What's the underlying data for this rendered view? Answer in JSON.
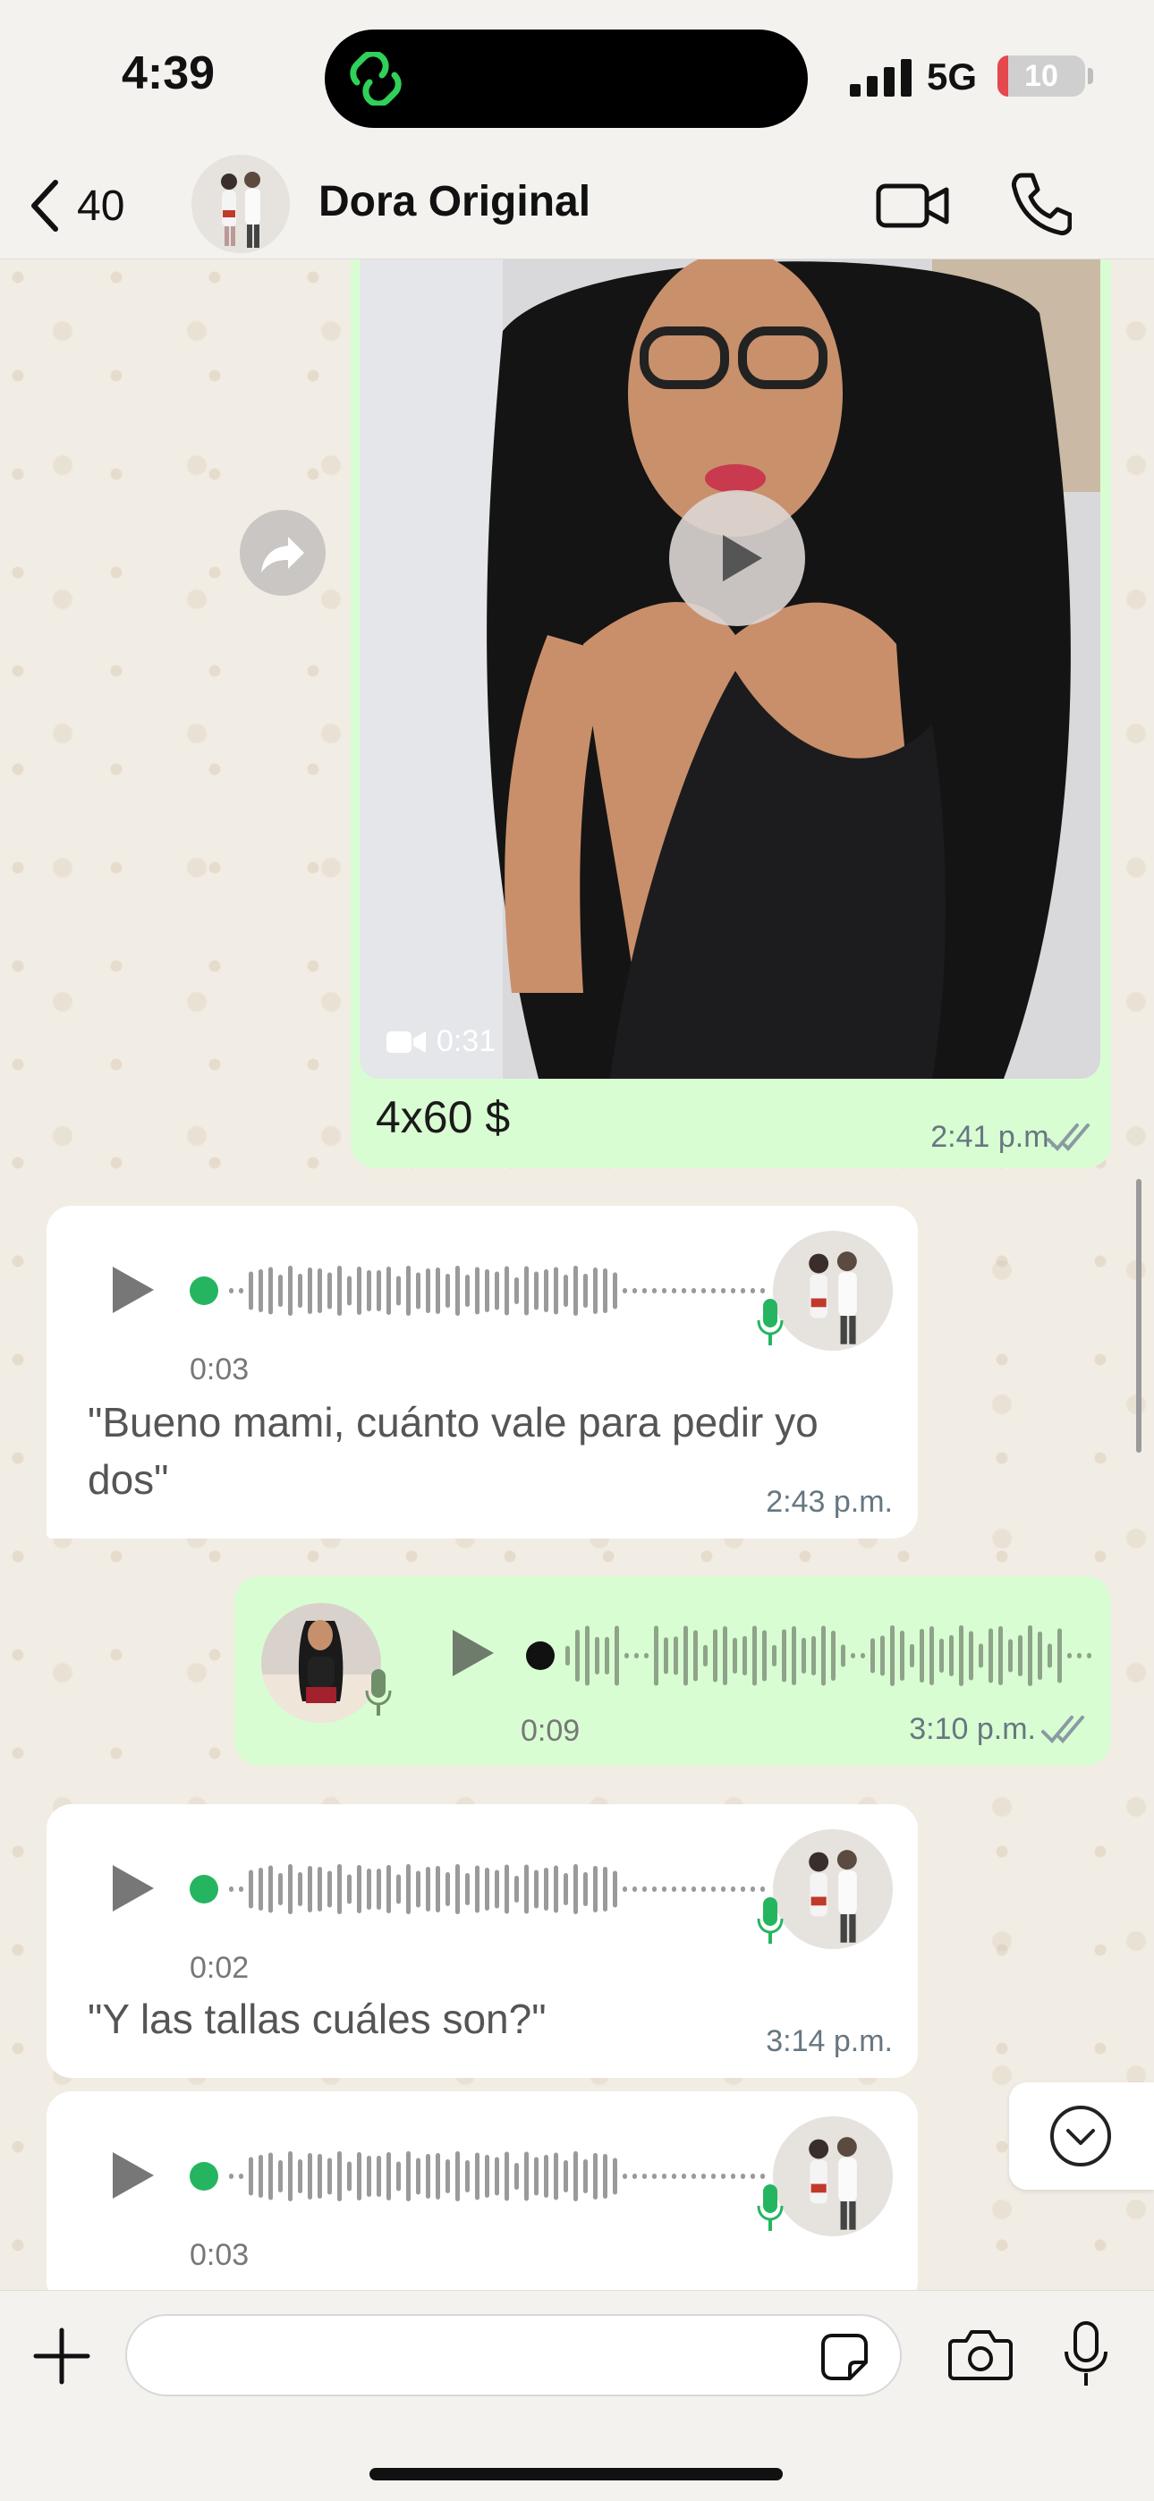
{
  "status_bar": {
    "time": "4:39",
    "network": "5G",
    "battery": "10",
    "battery_level": 0.1
  },
  "header": {
    "back_count": "40",
    "contact_name": "Dora Original"
  },
  "messages": [
    {
      "direction": "outgoing",
      "type": "video",
      "duration": "0:31",
      "caption": "4x60 $",
      "time": "2:41 p.m."
    },
    {
      "direction": "incoming",
      "type": "voice",
      "duration": "0:03",
      "transcript": "\"Bueno mami, cuánto vale para pedir yo dos\"",
      "time": "2:43 p.m."
    },
    {
      "direction": "outgoing",
      "type": "voice",
      "duration": "0:09",
      "time": "3:10 p.m."
    },
    {
      "direction": "incoming",
      "type": "voice",
      "duration": "0:02",
      "transcript": "\"Y las tallas cuáles son?\"",
      "time": "3:14 p.m."
    },
    {
      "direction": "incoming",
      "type": "voice",
      "duration": "0:03"
    }
  ],
  "input": {
    "placeholder": ""
  },
  "colors": {
    "accent": "#25d366",
    "outgoing_bubble": "#d9fdd3",
    "incoming_bubble": "#ffffff",
    "meta_text": "#667781"
  },
  "icons": [
    "back-chevron-icon",
    "video-call-icon",
    "phone-icon",
    "forward-icon",
    "play-icon",
    "mic-icon",
    "double-check-icon",
    "chevron-down-icon",
    "plus-icon",
    "sticker-icon",
    "camera-icon"
  ]
}
